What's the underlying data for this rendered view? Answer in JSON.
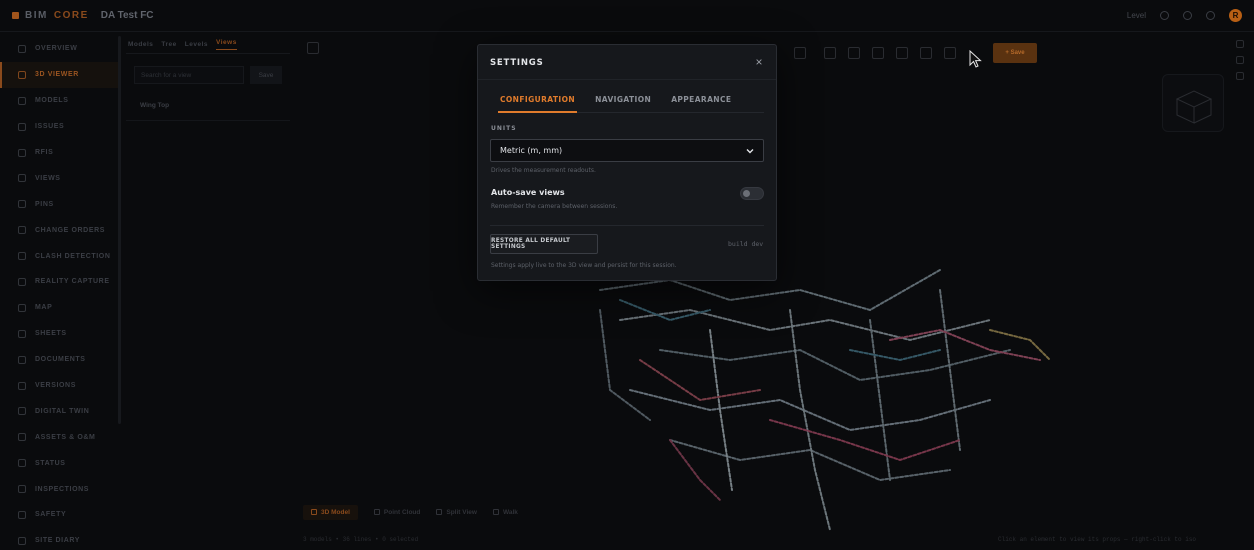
{
  "app": {
    "brand": {
      "prefix": "BIM",
      "suffix": "CORE"
    },
    "project": "DA Test FC",
    "user_initial": "R",
    "top_right_label": "Level"
  },
  "sidebar": {
    "items": [
      {
        "label": "Overview",
        "icon": "grid-icon",
        "active": false
      },
      {
        "label": "3D Viewer",
        "icon": "cube-icon",
        "active": true
      },
      {
        "label": "Models",
        "icon": "layers-icon",
        "active": false
      },
      {
        "label": "Issues",
        "icon": "alert-icon",
        "active": false
      },
      {
        "label": "RFIs",
        "icon": "chat-icon",
        "active": false
      },
      {
        "label": "Views",
        "icon": "eye-icon",
        "active": false
      },
      {
        "label": "Pins",
        "icon": "pin-icon",
        "active": false
      },
      {
        "label": "Change Orders",
        "icon": "doc-icon",
        "active": false
      },
      {
        "label": "Clash Detection",
        "icon": "target-icon",
        "active": false
      },
      {
        "label": "Reality Capture",
        "icon": "camera-icon",
        "active": false
      },
      {
        "label": "Map",
        "icon": "map-icon",
        "active": false
      },
      {
        "label": "Sheets",
        "icon": "pencil-icon",
        "active": false
      },
      {
        "label": "Documents",
        "icon": "folder-icon",
        "active": false
      },
      {
        "label": "Versions",
        "icon": "history-icon",
        "active": false
      },
      {
        "label": "Digital Twin",
        "icon": "twin-icon",
        "active": false
      },
      {
        "label": "Assets & O&M",
        "icon": "wrench-icon",
        "active": false
      },
      {
        "label": "Status",
        "icon": "status-icon",
        "active": false
      },
      {
        "label": "Inspections",
        "icon": "check-icon",
        "active": false
      },
      {
        "label": "Safety",
        "icon": "shield-icon",
        "active": false
      },
      {
        "label": "Site Diary",
        "icon": "book-icon",
        "active": false
      }
    ]
  },
  "panel": {
    "tabs": [
      "Models",
      "Tree",
      "Levels",
      "Views"
    ],
    "active_tab": "Views",
    "search_placeholder": "Search for a view",
    "button_label": "Save",
    "item": "Wing Top"
  },
  "toolbar": {
    "primary_label": "+ Save"
  },
  "bottom_tabs": [
    {
      "label": "3D Model",
      "active": true
    },
    {
      "label": "Point Cloud",
      "active": false
    },
    {
      "label": "Split View",
      "active": false
    },
    {
      "label": "Walk",
      "active": false
    }
  ],
  "status": {
    "left": "3 models • 36 lines • 0 selected",
    "right": "Click an element to view its props — right-click to iso"
  },
  "modal": {
    "title": "SETTINGS",
    "close_label": "×",
    "tabs": [
      "CONFIGURATION",
      "NAVIGATION",
      "APPEARANCE"
    ],
    "active_tab": "CONFIGURATION",
    "units_label": "UNITS",
    "units_value": "Metric (m, mm)",
    "units_hint": "Drives the measurement readouts.",
    "autosave_title": "Auto-save views",
    "autosave_hint": "Remember the camera between sessions.",
    "autosave_enabled": false,
    "restore_label": "RESTORE ALL DEFAULT SETTINGS",
    "build_label": "build dev",
    "footer_hint": "Settings apply live to the 3D view and persist for this session."
  },
  "colors": {
    "accent": "#e07b2c",
    "modal_bg": "#16181c",
    "page_bg": "#0a0b0d"
  }
}
